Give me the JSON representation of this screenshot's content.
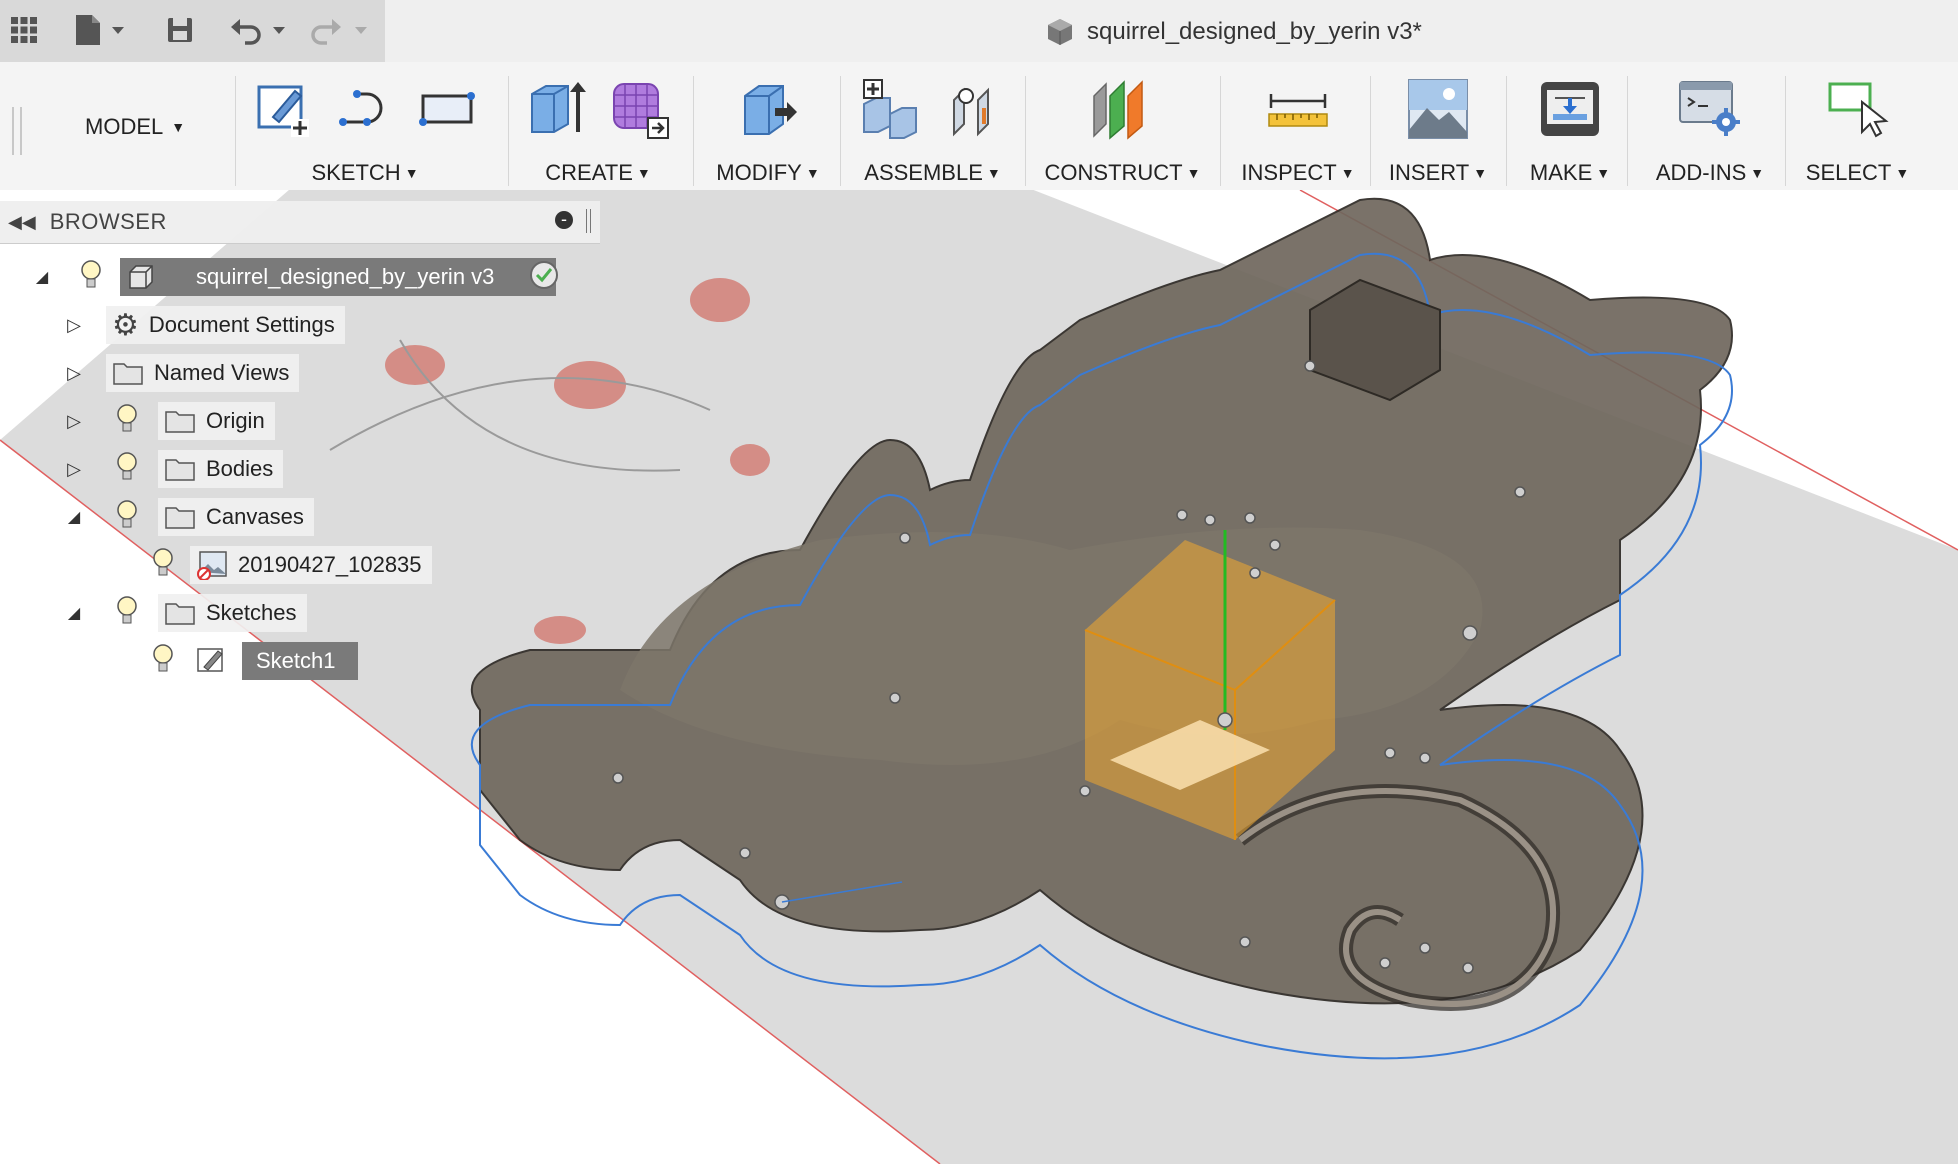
{
  "window": {
    "title": "squirrel_designed_by_yerin v3*"
  },
  "quick_access": {
    "icons": [
      "grid-icon",
      "file-icon",
      "save-icon",
      "undo-icon",
      "redo-icon"
    ]
  },
  "toolbar": {
    "workspace_label": "MODEL",
    "groups": [
      {
        "label": "SKETCH"
      },
      {
        "label": "CREATE"
      },
      {
        "label": "MODIFY"
      },
      {
        "label": "ASSEMBLE"
      },
      {
        "label": "CONSTRUCT"
      },
      {
        "label": "INSPECT"
      },
      {
        "label": "INSERT"
      },
      {
        "label": "MAKE"
      },
      {
        "label": "ADD-INS"
      },
      {
        "label": "SELECT"
      }
    ]
  },
  "browser": {
    "title": "BROWSER",
    "root": {
      "label": "squirrel_designed_by_yerin v3"
    },
    "items": [
      {
        "label": "Document Settings"
      },
      {
        "label": "Named Views"
      },
      {
        "label": "Origin"
      },
      {
        "label": "Bodies"
      },
      {
        "label": "Canvases"
      },
      {
        "label": "20190427_102835"
      },
      {
        "label": "Sketches"
      },
      {
        "label": "Sketch1"
      }
    ]
  },
  "colors": {
    "accent_blue": "#3a7bd5",
    "selection_orange": "#f0a830",
    "model_body": "#6f675d"
  }
}
